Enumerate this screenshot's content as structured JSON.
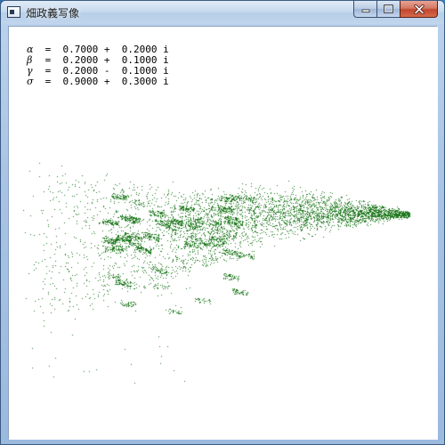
{
  "window": {
    "title": "畑政義写像"
  },
  "caption_buttons": {
    "minimize_icon": "minimize-icon",
    "maximize_icon": "maximize-icon",
    "close_icon": "close-icon"
  },
  "parameters": [
    {
      "symbol": "α",
      "text": " =  0.7000 +  0.2000 i"
    },
    {
      "symbol": "β",
      "text": " =  0.2000 +  0.1000 i"
    },
    {
      "symbol": "γ",
      "text": " =  0.2000 -  0.1000 i"
    },
    {
      "symbol": "σ",
      "text": " =  0.9000 +  0.3000 i"
    }
  ],
  "colors": {
    "fractal": "#1f7a1f",
    "background": "#ffffff"
  }
}
